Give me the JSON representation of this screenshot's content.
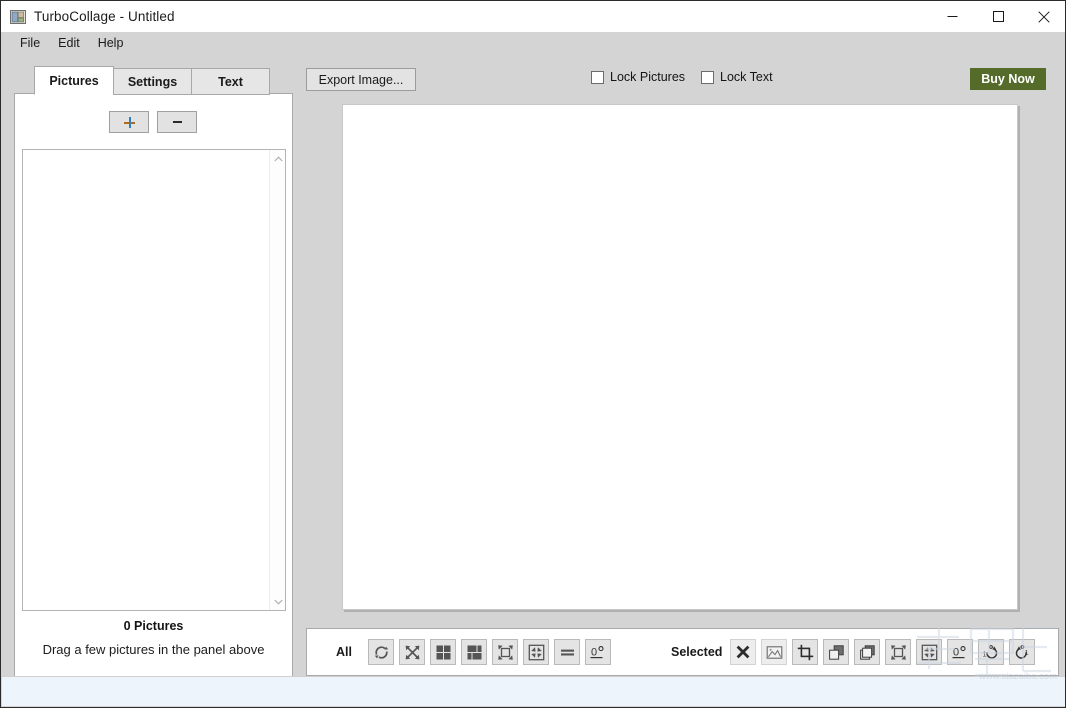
{
  "window": {
    "title": "TurboCollage - Untitled",
    "app_icon": "collage-app-icon",
    "minimize_label": "Minimize",
    "maximize_label": "Maximize",
    "close_label": "Close"
  },
  "menubar": {
    "items": [
      {
        "label": "File",
        "name": "menu-file"
      },
      {
        "label": "Edit",
        "name": "menu-edit"
      },
      {
        "label": "Help",
        "name": "menu-help"
      }
    ]
  },
  "left_panel": {
    "tabs": [
      {
        "label": "Pictures",
        "active": true
      },
      {
        "label": "Settings",
        "active": false
      },
      {
        "label": "Text",
        "active": false
      }
    ],
    "add_button": "+",
    "remove_button": "-",
    "picture_count": "0 Pictures",
    "hint": "Drag a few pictures in the panel above",
    "scrollbar": {
      "up_icon": "chevron-up-icon",
      "down_icon": "chevron-down-icon"
    }
  },
  "toolbar": {
    "export_label": "Export Image...",
    "lock_pictures_label": "Lock Pictures",
    "lock_pictures_checked": false,
    "lock_text_label": "Lock Text",
    "lock_text_checked": false,
    "buy_now_label": "Buy Now",
    "buy_now_color": "#556b2a"
  },
  "bottom_toolbar": {
    "all_label": "All",
    "all_tools": [
      {
        "name": "shuffle-rotate-icon",
        "icon": "circular-arrows"
      },
      {
        "name": "shuffle-positions-icon",
        "icon": "cross-arrows"
      },
      {
        "name": "equal-grid-icon",
        "icon": "grid-four-equal"
      },
      {
        "name": "mixed-grid-icon",
        "icon": "grid-mixed"
      },
      {
        "name": "expand-all-icon",
        "icon": "expand-outward"
      },
      {
        "name": "shrink-all-icon",
        "icon": "shrink-inward"
      },
      {
        "name": "equalize-size-icon",
        "icon": "equals"
      },
      {
        "name": "reset-rotation-icon",
        "icon": "zero-degrees",
        "label": "0°"
      }
    ],
    "selected_label": "Selected",
    "selected_tools": [
      {
        "name": "delete-selected-icon",
        "icon": "x-mark"
      },
      {
        "name": "replace-picture-icon",
        "icon": "picture"
      },
      {
        "name": "crop-picture-icon",
        "icon": "crop"
      },
      {
        "name": "bring-to-front-icon",
        "icon": "layers-front"
      },
      {
        "name": "send-to-back-icon",
        "icon": "layers-back"
      },
      {
        "name": "enlarge-selected-icon",
        "icon": "expand-outward"
      },
      {
        "name": "shrink-selected-icon",
        "icon": "shrink-inward"
      },
      {
        "name": "reset-rotation-selected-icon",
        "icon": "zero-degrees",
        "label": "0°"
      },
      {
        "name": "rotate-counterclockwise-icon",
        "icon": "rotate-ccw-1deg",
        "label": "1°"
      },
      {
        "name": "rotate-clockwise-icon",
        "icon": "rotate-cw-1deg",
        "label": "1°"
      }
    ]
  },
  "watermark": {
    "text": "www.xiazaiba.com"
  }
}
